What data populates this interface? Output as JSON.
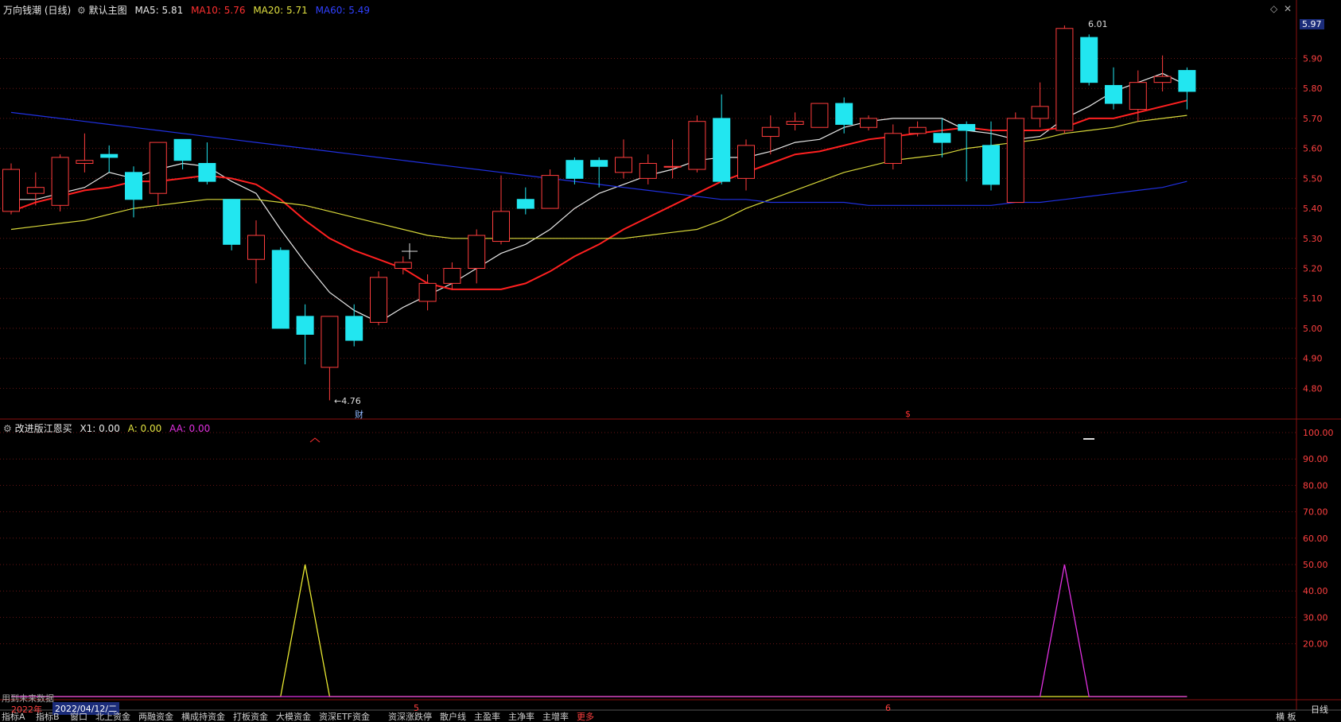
{
  "header": {
    "stock_title": "万向钱潮 (日线)",
    "main_chart_label": "默认主图",
    "ma5": "MA5: 5.81",
    "ma10": "MA10: 5.76",
    "ma20": "MA20: 5.71",
    "ma60": "MA60: 5.49",
    "current_price_badge": "5.97"
  },
  "indicator": {
    "title": "改进版江恩买",
    "x1": "X1: 0.00",
    "a": "A: 0.00",
    "aa": "AA: 0.00",
    "future_data_note": "用到未来数据"
  },
  "annotations": {
    "low_label": "←4.76",
    "high_label": "6.01",
    "fin_marker": "财",
    "dollar_marker": "$"
  },
  "time_axis": {
    "year_label": "2022年",
    "date_label": "2022/04/12/二",
    "month_5": "5",
    "month_6": "6",
    "period_label": "日线"
  },
  "bottom_tabs": [
    "指标A",
    "指标B",
    "窗口",
    "北上资金",
    "两融资金",
    "横成持资金",
    "打板资金",
    "大模资金",
    "资深ETF资金",
    "资深涨跌停",
    "散户线",
    "主盈率",
    "主净率",
    "主增率",
    "更多"
  ],
  "bottom_right": "横 板",
  "colors": {
    "up": "#ff3d3d",
    "down": "#22e6f0",
    "ma5": "#e8e8e8",
    "ma10": "#ff2020",
    "ma20": "#d8d83a",
    "ma60": "#2030e0",
    "indicator_a": "#e8e830",
    "indicator_aa": "#e030e0"
  },
  "chart_data": [
    {
      "type": "candlestick",
      "title": "万向钱潮 (日线)",
      "ylim": [
        4.74,
        6.01
      ],
      "y_ticks": [
        4.8,
        4.9,
        5.0,
        5.1,
        5.2,
        5.3,
        5.4,
        5.5,
        5.6,
        5.7,
        5.8,
        5.9
      ],
      "candles": [
        {
          "o": 5.39,
          "c": 5.53,
          "h": 5.55,
          "l": 5.38
        },
        {
          "o": 5.45,
          "c": 5.47,
          "h": 5.52,
          "l": 5.41
        },
        {
          "o": 5.41,
          "c": 5.57,
          "h": 5.58,
          "l": 5.39
        },
        {
          "o": 5.55,
          "c": 5.56,
          "h": 5.65,
          "l": 5.52
        },
        {
          "o": 5.58,
          "c": 5.57,
          "h": 5.61,
          "l": 5.52
        },
        {
          "o": 5.52,
          "c": 5.43,
          "h": 5.54,
          "l": 5.37
        },
        {
          "o": 5.45,
          "c": 5.62,
          "h": 5.62,
          "l": 5.41
        },
        {
          "o": 5.63,
          "c": 5.56,
          "h": 5.63,
          "l": 5.53
        },
        {
          "o": 5.55,
          "c": 5.49,
          "h": 5.62,
          "l": 5.48
        },
        {
          "o": 5.43,
          "c": 5.28,
          "h": 5.43,
          "l": 5.26
        },
        {
          "o": 5.23,
          "c": 5.31,
          "h": 5.36,
          "l": 5.15
        },
        {
          "o": 5.26,
          "c": 5.0,
          "h": 5.27,
          "l": 5.0
        },
        {
          "o": 5.04,
          "c": 4.98,
          "h": 5.08,
          "l": 4.88
        },
        {
          "o": 4.87,
          "c": 5.04,
          "h": 5.04,
          "l": 4.76
        },
        {
          "o": 5.04,
          "c": 4.96,
          "h": 5.08,
          "l": 4.94
        },
        {
          "o": 5.02,
          "c": 5.17,
          "h": 5.19,
          "l": 5.01
        },
        {
          "o": 5.2,
          "c": 5.22,
          "h": 5.24,
          "l": 5.18
        },
        {
          "o": 5.09,
          "c": 5.15,
          "h": 5.18,
          "l": 5.06
        },
        {
          "o": 5.15,
          "c": 5.2,
          "h": 5.22,
          "l": 5.13
        },
        {
          "o": 5.2,
          "c": 5.31,
          "h": 5.33,
          "l": 5.15
        },
        {
          "o": 5.29,
          "c": 5.39,
          "h": 5.51,
          "l": 5.28
        },
        {
          "o": 5.43,
          "c": 5.4,
          "h": 5.47,
          "l": 5.38
        },
        {
          "o": 5.4,
          "c": 5.51,
          "h": 5.53,
          "l": 5.4
        },
        {
          "o": 5.56,
          "c": 5.5,
          "h": 5.57,
          "l": 5.48
        },
        {
          "o": 5.56,
          "c": 5.54,
          "h": 5.57,
          "l": 5.47
        },
        {
          "o": 5.52,
          "c": 5.57,
          "h": 5.63,
          "l": 5.5
        },
        {
          "o": 5.5,
          "c": 5.55,
          "h": 5.58,
          "l": 5.48
        },
        {
          "o": 5.54,
          "c": 5.54,
          "h": 5.63,
          "l": 5.5
        },
        {
          "o": 5.53,
          "c": 5.69,
          "h": 5.71,
          "l": 5.52
        },
        {
          "o": 5.7,
          "c": 5.49,
          "h": 5.78,
          "l": 5.48
        },
        {
          "o": 5.5,
          "c": 5.61,
          "h": 5.63,
          "l": 5.46
        },
        {
          "o": 5.64,
          "c": 5.67,
          "h": 5.71,
          "l": 5.58
        },
        {
          "o": 5.68,
          "c": 5.69,
          "h": 5.72,
          "l": 5.66
        },
        {
          "o": 5.67,
          "c": 5.75,
          "h": 5.75,
          "l": 5.67
        },
        {
          "o": 5.75,
          "c": 5.68,
          "h": 5.77,
          "l": 5.65
        },
        {
          "o": 5.67,
          "c": 5.7,
          "h": 5.71,
          "l": 5.66
        },
        {
          "o": 5.55,
          "c": 5.65,
          "h": 5.68,
          "l": 5.53
        },
        {
          "o": 5.65,
          "c": 5.67,
          "h": 5.69,
          "l": 5.64
        },
        {
          "o": 5.65,
          "c": 5.62,
          "h": 5.7,
          "l": 5.57
        },
        {
          "o": 5.68,
          "c": 5.66,
          "h": 5.69,
          "l": 5.49
        },
        {
          "o": 5.61,
          "c": 5.48,
          "h": 5.69,
          "l": 5.46
        },
        {
          "o": 5.42,
          "c": 5.7,
          "h": 5.72,
          "l": 5.42
        },
        {
          "o": 5.7,
          "c": 5.74,
          "h": 5.82,
          "l": 5.67
        },
        {
          "o": 5.66,
          "c": 6.0,
          "h": 6.01,
          "l": 5.65
        },
        {
          "o": 5.97,
          "c": 5.82,
          "h": 5.98,
          "l": 5.81
        },
        {
          "o": 5.81,
          "c": 5.75,
          "h": 5.87,
          "l": 5.73
        },
        {
          "o": 5.73,
          "c": 5.82,
          "h": 5.86,
          "l": 5.69
        },
        {
          "o": 5.82,
          "c": 5.84,
          "h": 5.91,
          "l": 5.79
        },
        {
          "o": 5.86,
          "c": 5.79,
          "h": 5.87,
          "l": 5.73
        }
      ],
      "series": [
        {
          "name": "MA5",
          "values": [
            5.43,
            5.43,
            5.45,
            5.47,
            5.52,
            5.5,
            5.53,
            5.55,
            5.54,
            5.49,
            5.45,
            5.33,
            5.22,
            5.12,
            5.06,
            5.02,
            5.07,
            5.11,
            5.15,
            5.2,
            5.25,
            5.28,
            5.33,
            5.4,
            5.45,
            5.48,
            5.51,
            5.53,
            5.56,
            5.57,
            5.57,
            5.59,
            5.62,
            5.63,
            5.67,
            5.69,
            5.7,
            5.7,
            5.7,
            5.66,
            5.65,
            5.63,
            5.64,
            5.7,
            5.74,
            5.79,
            5.82,
            5.85,
            5.81
          ]
        },
        {
          "name": "MA10",
          "values": [
            5.39,
            5.42,
            5.44,
            5.46,
            5.47,
            5.49,
            5.49,
            5.5,
            5.51,
            5.5,
            5.48,
            5.43,
            5.36,
            5.3,
            5.26,
            5.23,
            5.2,
            5.15,
            5.13,
            5.13,
            5.13,
            5.15,
            5.19,
            5.24,
            5.28,
            5.33,
            5.37,
            5.41,
            5.45,
            5.49,
            5.52,
            5.55,
            5.58,
            5.59,
            5.61,
            5.63,
            5.64,
            5.65,
            5.66,
            5.67,
            5.66,
            5.66,
            5.66,
            5.67,
            5.7,
            5.7,
            5.72,
            5.74,
            5.76
          ]
        },
        {
          "name": "MA20",
          "values": [
            5.33,
            5.34,
            5.35,
            5.36,
            5.38,
            5.4,
            5.41,
            5.42,
            5.43,
            5.43,
            5.43,
            5.42,
            5.41,
            5.39,
            5.37,
            5.35,
            5.33,
            5.31,
            5.3,
            5.3,
            5.3,
            5.3,
            5.3,
            5.3,
            5.3,
            5.3,
            5.31,
            5.32,
            5.33,
            5.36,
            5.4,
            5.43,
            5.46,
            5.49,
            5.52,
            5.54,
            5.56,
            5.57,
            5.58,
            5.6,
            5.61,
            5.62,
            5.63,
            5.65,
            5.66,
            5.67,
            5.69,
            5.7,
            5.71
          ]
        },
        {
          "name": "MA60",
          "values": [
            5.72,
            5.71,
            5.7,
            5.69,
            5.68,
            5.67,
            5.66,
            5.65,
            5.64,
            5.63,
            5.62,
            5.61,
            5.6,
            5.59,
            5.58,
            5.57,
            5.56,
            5.55,
            5.54,
            5.53,
            5.52,
            5.51,
            5.5,
            5.49,
            5.48,
            5.47,
            5.46,
            5.45,
            5.44,
            5.43,
            5.43,
            5.42,
            5.42,
            5.42,
            5.42,
            5.41,
            5.41,
            5.41,
            5.41,
            5.41,
            5.41,
            5.42,
            5.42,
            5.43,
            5.44,
            5.45,
            5.46,
            5.47,
            5.49
          ]
        }
      ]
    },
    {
      "type": "line",
      "title": "改进版江恩买",
      "ylim": [
        0,
        100
      ],
      "y_ticks": [
        20,
        30,
        40,
        50,
        60,
        70,
        80,
        90,
        100
      ],
      "series": [
        {
          "name": "A",
          "values": [
            0,
            0,
            0,
            0,
            0,
            0,
            0,
            0,
            0,
            0,
            0,
            0,
            50,
            0,
            0,
            0,
            0,
            0,
            0,
            0,
            0,
            0,
            0,
            0,
            0,
            0,
            0,
            0,
            0,
            0,
            0,
            0,
            0,
            0,
            0,
            0,
            0,
            0,
            0,
            0,
            0,
            0,
            0,
            0,
            0,
            0,
            0,
            0,
            0
          ]
        },
        {
          "name": "AA",
          "values": [
            0,
            0,
            0,
            0,
            0,
            0,
            0,
            0,
            0,
            0,
            0,
            0,
            0,
            0,
            0,
            0,
            0,
            0,
            0,
            0,
            0,
            0,
            0,
            0,
            0,
            0,
            0,
            0,
            0,
            0,
            0,
            0,
            0,
            0,
            0,
            0,
            0,
            0,
            0,
            0,
            0,
            0,
            0,
            50,
            0,
            0,
            0,
            0,
            0
          ]
        }
      ]
    }
  ]
}
